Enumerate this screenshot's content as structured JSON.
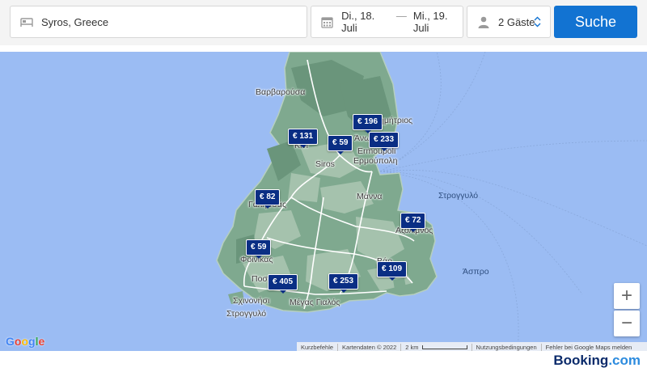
{
  "search": {
    "destination": "Syros, Greece",
    "checkin": "Di., 18. Juli",
    "separator": "—",
    "checkout": "Mi., 19. Juli",
    "guests": "2 Gäste",
    "button_label": "Suche",
    "icons": [
      "bed-icon",
      "calendar-icon",
      "person-icon",
      "sort-arrows-icon"
    ]
  },
  "map": {
    "places": {
      "varvarousa": "Βαρβαρούσα",
      "dimitrios": "Δημήτριος",
      "ano": "Άνω Σ",
      "kini": "Κίνι",
      "siros": "Siros",
      "ermoupoli_latin": "Ermoupoli",
      "ermoupoli_greek": "Ερμούπολη",
      "manna": "Μάννα",
      "strongylo_east": "Στρογγυλό",
      "galissas": "Γαλησσάς",
      "azolimnos": "Αζόλιμνος",
      "foinikas": "Φοίνικας",
      "aspro": "Άσπρο",
      "vari": "Βάρ",
      "posidonia": "Ποσ",
      "megas_gialos": "Μέγας Γιαλός",
      "schinonisi": "Σχινονήσι",
      "strongylo_south": "Στρογγυλό"
    },
    "markers": [
      {
        "id": "m131",
        "price": "€ 131"
      },
      {
        "id": "m196",
        "price": "€ 196"
      },
      {
        "id": "m59a",
        "price": "€ 59"
      },
      {
        "id": "m233",
        "price": "€ 233"
      },
      {
        "id": "m82",
        "price": "€ 82"
      },
      {
        "id": "m72",
        "price": "€ 72"
      },
      {
        "id": "m59b",
        "price": "€ 59"
      },
      {
        "id": "m109",
        "price": "€ 109"
      },
      {
        "id": "m405",
        "price": "€ 405"
      },
      {
        "id": "m253",
        "price": "€ 253"
      }
    ],
    "zoom_in": "+",
    "zoom_out": "−",
    "google_logo": {
      "G": "G",
      "o1": "o",
      "o2": "o",
      "g": "g",
      "l": "l",
      "e": "e"
    },
    "attribution": {
      "shortcuts": "Kurzbefehle",
      "mapdata": "Kartendaten © 2022",
      "scale": "2 km",
      "terms": "Nutzungsbedingungen",
      "report": "Fehler bei Google Maps melden"
    },
    "colors": {
      "water": "#9bbcf3",
      "land": "#7fa98f",
      "marker": "#0a2e84"
    }
  },
  "footer": {
    "brand_name": "Booking",
    "brand_suffix": ".com"
  },
  "colors": {
    "search_button": "#1273d2",
    "brand": "#0b2b6b"
  }
}
